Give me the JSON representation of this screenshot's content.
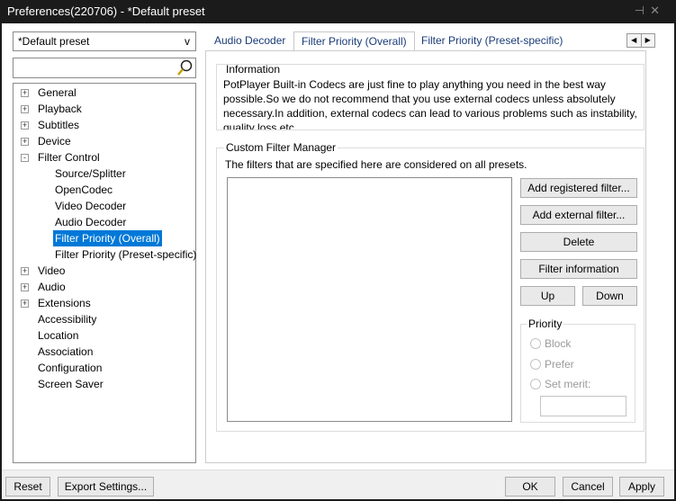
{
  "window": {
    "title": "Preferences(220706) - *Default preset"
  },
  "preset_select": {
    "value": "*Default preset",
    "arrow": "v"
  },
  "search": {
    "value": ""
  },
  "tree": [
    {
      "label": "General",
      "expander": "+",
      "level": 0
    },
    {
      "label": "Playback",
      "expander": "+",
      "level": 0
    },
    {
      "label": "Subtitles",
      "expander": "+",
      "level": 0
    },
    {
      "label": "Device",
      "expander": "+",
      "level": 0
    },
    {
      "label": "Filter Control",
      "expander": "-",
      "level": 0
    },
    {
      "label": "Source/Splitter",
      "level": 1
    },
    {
      "label": "OpenCodec",
      "level": 1
    },
    {
      "label": "Video Decoder",
      "level": 1
    },
    {
      "label": "Audio Decoder",
      "level": 1
    },
    {
      "label": "Filter Priority (Overall)",
      "level": 1,
      "selected": true
    },
    {
      "label": "Filter Priority (Preset-specific)",
      "level": 1
    },
    {
      "label": "Video",
      "expander": "+",
      "level": 0
    },
    {
      "label": "Audio",
      "expander": "+",
      "level": 0
    },
    {
      "label": "Extensions",
      "expander": "+",
      "level": 0
    },
    {
      "label": "Accessibility",
      "level": 0
    },
    {
      "label": "Location",
      "level": 0
    },
    {
      "label": "Association",
      "level": 0
    },
    {
      "label": "Configuration",
      "level": 0
    },
    {
      "label": "Screen Saver",
      "level": 0
    }
  ],
  "tabs": [
    "Audio Decoder",
    "Filter Priority (Overall)",
    "Filter Priority (Preset-specific)"
  ],
  "info": {
    "title": "Information",
    "text": "PotPlayer Built-in Codecs are just fine to play anything you need in the best way possible.So we do not recommend that you use external codecs unless absolutely necessary.In addition, external codecs can lead to various problems such as instability, quality loss etc."
  },
  "cfm": {
    "title": "Custom Filter Manager",
    "desc": "The filters that are specified here are considered on all presets.",
    "buttons": {
      "add_registered": "Add registered filter...",
      "add_external": "Add external filter...",
      "delete": "Delete",
      "info": "Filter information",
      "up": "Up",
      "down": "Down"
    },
    "priority": {
      "title": "Priority",
      "block": "Block",
      "prefer": "Prefer",
      "set_merit": "Set merit:",
      "merit_value": ""
    }
  },
  "footer": {
    "reset": "Reset",
    "export": "Export Settings...",
    "ok": "OK",
    "cancel": "Cancel",
    "apply": "Apply"
  },
  "colors": {
    "selection": "#0078d7",
    "titlebar": "#1b1b1b"
  }
}
